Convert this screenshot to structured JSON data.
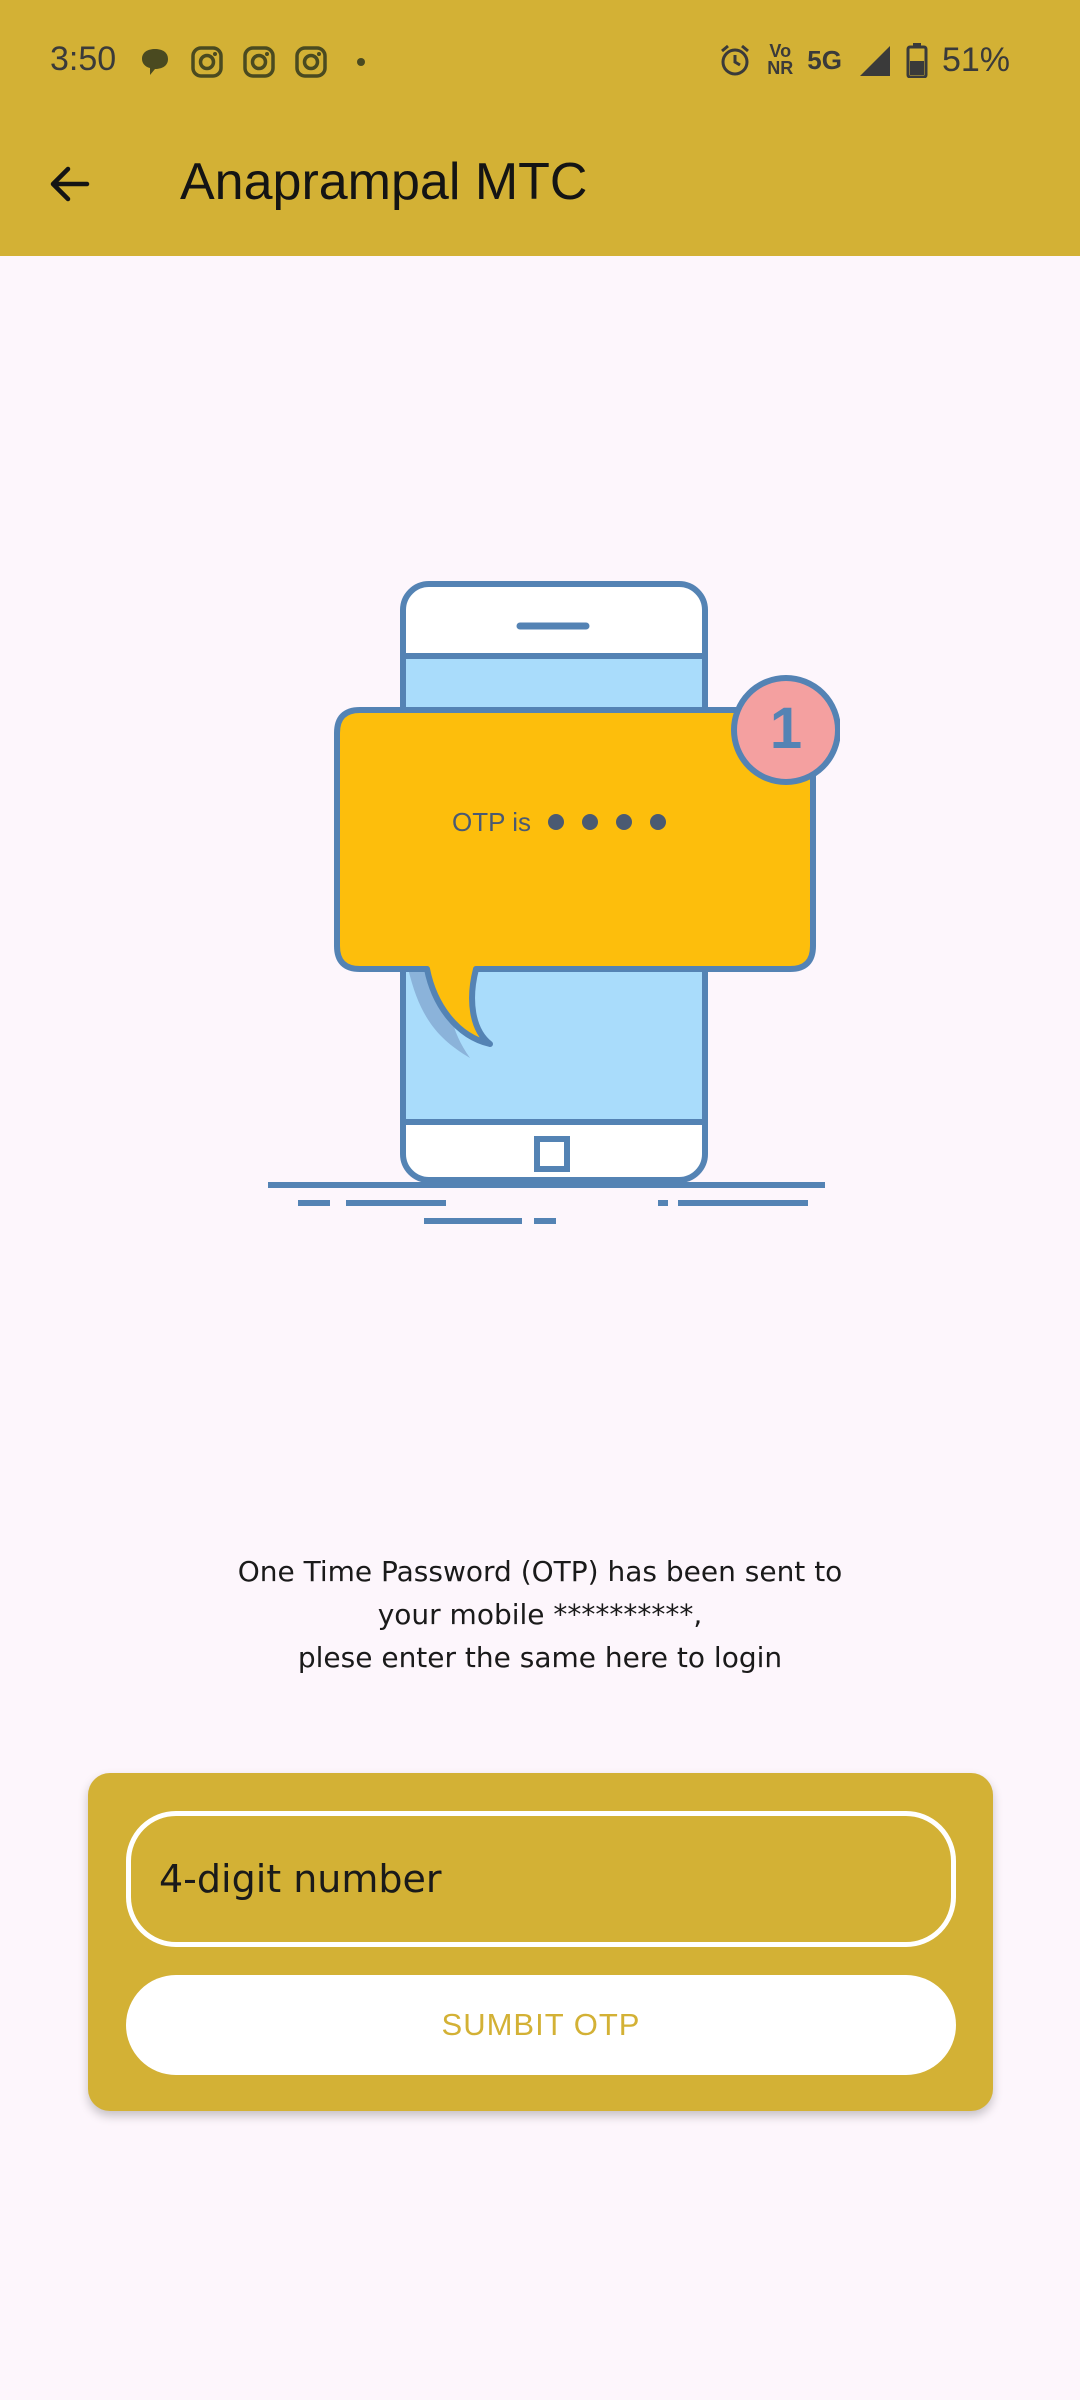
{
  "status_bar": {
    "time": "3:50",
    "network_top": "Vo",
    "network_bottom": "NR",
    "network_5g": "5G",
    "battery_percent": "51%",
    "left_icons": [
      "message-bubble-icon",
      "instagram-icon",
      "instagram-icon",
      "instagram-icon",
      "dot-icon"
    ],
    "right_icons": [
      "alarm-icon",
      "volte-icon",
      "5g-icon",
      "signal-icon",
      "battery-icon"
    ]
  },
  "app_bar": {
    "title": "Anaprampal MTC",
    "back_icon": "arrow-left-icon",
    "background": "#D3B135"
  },
  "illustration": {
    "otp_text": "OTP is",
    "badge_count": "1"
  },
  "message": {
    "line1": "One Time Password (OTP) has been sent to",
    "line2": "your mobile **********,",
    "line3": "plese enter the same here to login"
  },
  "form": {
    "otp_placeholder": "4-digit number",
    "otp_value": "",
    "submit_label": "SUMBIT OTP"
  },
  "colors": {
    "accent": "#D3B135",
    "background": "#FDF6FC",
    "bubble": "#FDBE0C",
    "phone_screen": "#A9DCFB",
    "outline": "#5483B4",
    "badge": "#F4A0A0"
  }
}
